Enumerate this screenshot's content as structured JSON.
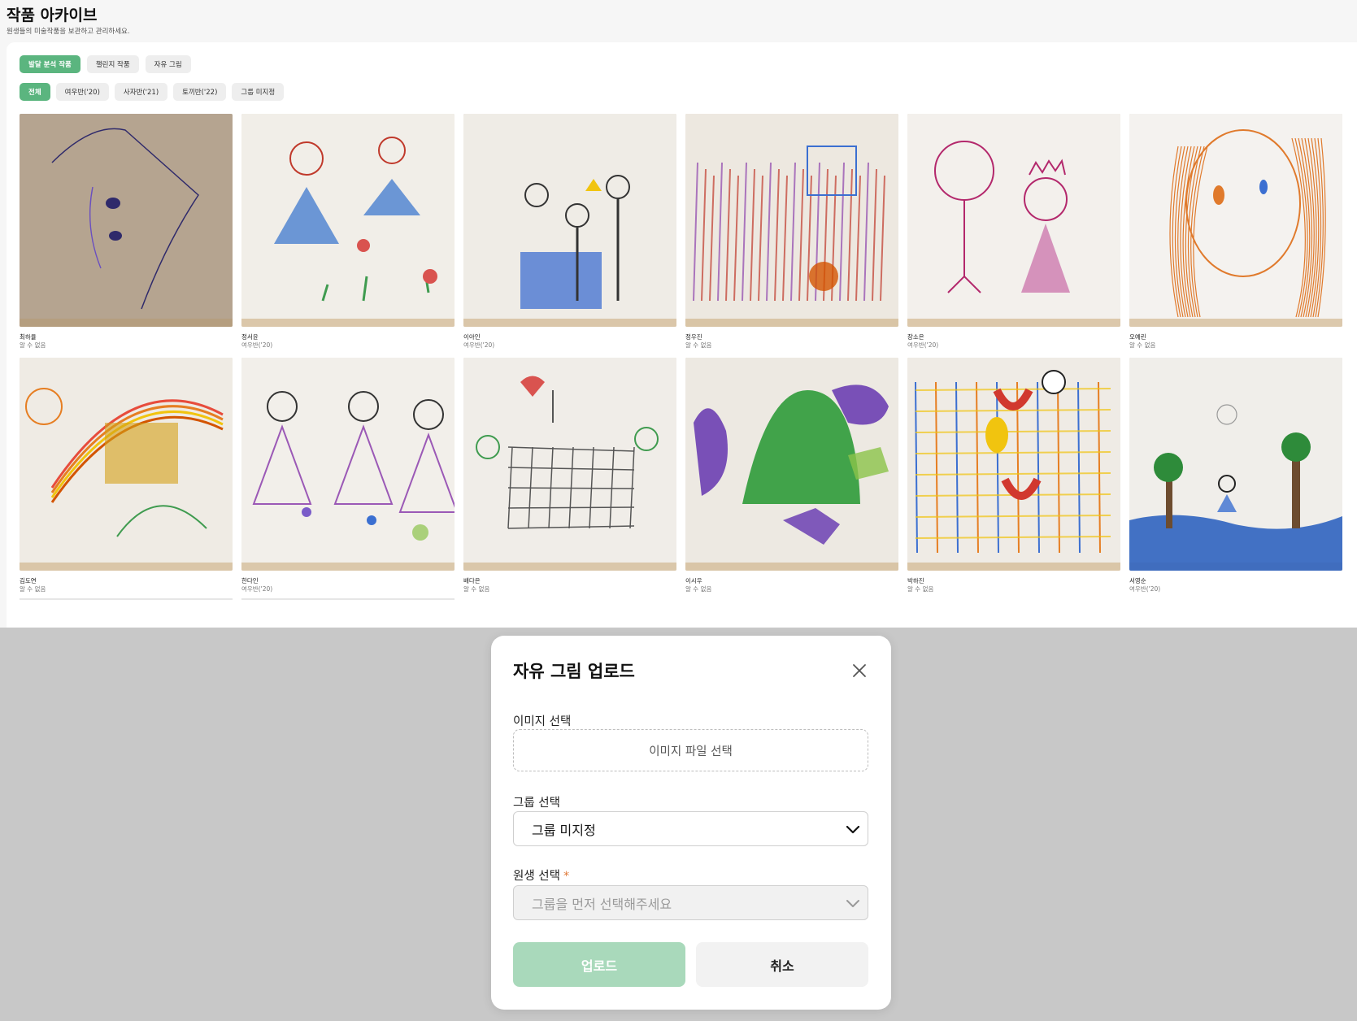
{
  "page": {
    "title": "작품 아카이브",
    "subtitle": "원생들의 미술작품을 보관하고 관리하세요."
  },
  "tabs": [
    {
      "label": "발달 분석 작품",
      "active": true
    },
    {
      "label": "챌린지 작품",
      "active": false
    },
    {
      "label": "자유 그림",
      "active": false
    }
  ],
  "filters": [
    {
      "label": "전체",
      "active": true
    },
    {
      "label": "여우반('20)",
      "active": false
    },
    {
      "label": "사자반('21)",
      "active": false
    },
    {
      "label": "토끼반('22)",
      "active": false
    },
    {
      "label": "그룹 미지정",
      "active": false
    }
  ],
  "artworks": [
    {
      "name": "최하율",
      "group": "알 수 없음",
      "theme": "face-blur",
      "bg": "#c9b9a5",
      "ink": "#2f2a6b"
    },
    {
      "name": "정서윤",
      "group": "여우반('20)",
      "theme": "two-girls-blue",
      "bg": "#f1eee8",
      "ink": "#4a7fd0"
    },
    {
      "name": "이아인",
      "group": "여우반('20)",
      "theme": "family-pencil",
      "bg": "#efece6",
      "ink": "#333333"
    },
    {
      "name": "정우진",
      "group": "알 수 없음",
      "theme": "scribble-red",
      "bg": "#ede8e0",
      "ink": "#c0392b"
    },
    {
      "name": "장소은",
      "group": "여우반('20)",
      "theme": "two-princess",
      "bg": "#f3f0ec",
      "ink": "#b3286c"
    },
    {
      "name": "오예린",
      "group": "알 수 없음",
      "theme": "orange-face",
      "bg": "#f4f2ef",
      "ink": "#e07a2c"
    },
    {
      "name": "김도연",
      "group": "알 수 없음",
      "theme": "rainbow",
      "bg": "#efebe4",
      "ink": "#d98a2b"
    },
    {
      "name": "한다인",
      "group": "여우반('20)",
      "theme": "three-girls",
      "bg": "#f2efea",
      "ink": "#7a5cc9"
    },
    {
      "name": "배다은",
      "group": "알 수 없음",
      "theme": "grid-people",
      "bg": "#f0ede8",
      "ink": "#3f9b4f"
    },
    {
      "name": "이시우",
      "group": "알 수 없음",
      "theme": "green-purple",
      "bg": "#ede9e2",
      "ink": "#6b3fb3"
    },
    {
      "name": "박하진",
      "group": "알 수 없음",
      "theme": "colorful-grid",
      "bg": "#efebe5",
      "ink": "#d1382f"
    },
    {
      "name": "서영순",
      "group": "여우반('20)",
      "theme": "landscape",
      "bg": "#f0eeea",
      "ink": "#2f63c0"
    }
  ],
  "modal": {
    "title": "자유 그림 업로드",
    "image_label": "이미지 선택",
    "file_button": "이미지 파일 선택",
    "group_label": "그룹 선택",
    "group_value": "그룹 미지정",
    "student_label": "원생 선택",
    "required": "*",
    "student_placeholder": "그룹을 먼저 선택해주세요",
    "upload_button": "업로드",
    "cancel_button": "취소"
  },
  "colors": {
    "accent": "#5bb57f",
    "upload_disabled": "#a9d9bb",
    "overlay": "#c8c8c8"
  },
  "icons": {
    "close": "close-icon",
    "chevron": "chevron-down-icon"
  }
}
